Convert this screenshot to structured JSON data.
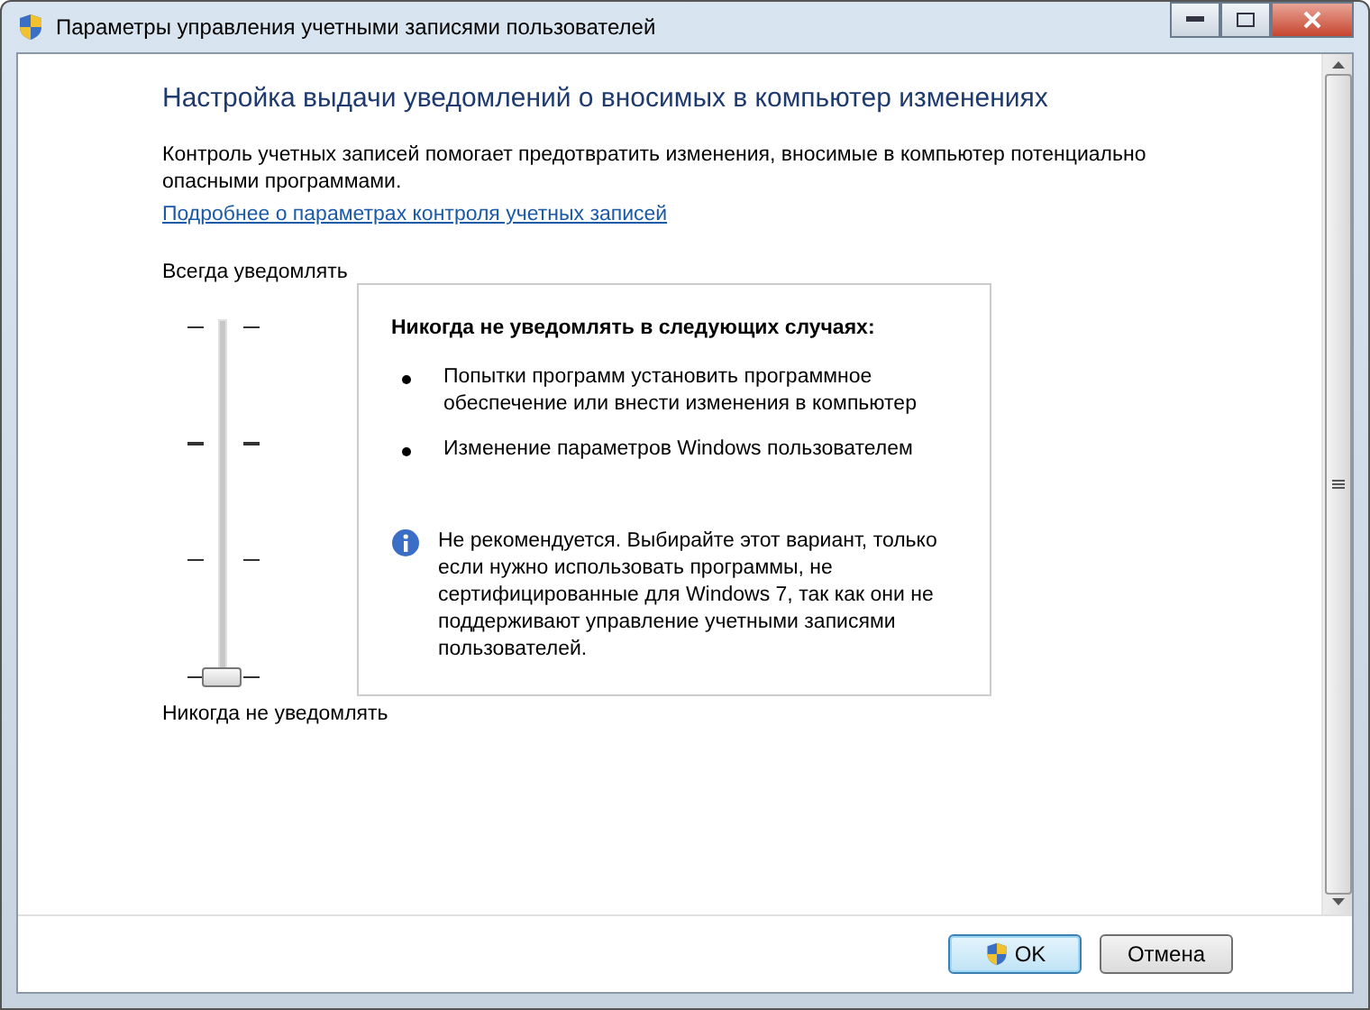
{
  "window": {
    "title": "Параметры управления учетными записями пользователей"
  },
  "heading": "Настройка выдачи уведомлений о вносимых в компьютер изменениях",
  "description": "Контроль учетных записей помогает предотвратить изменения, вносимые в компьютер потенциально опасными программами.",
  "link": "Подробнее о параметрах контроля учетных записей",
  "slider": {
    "top_label": "Всегда уведомлять",
    "bottom_label": "Никогда не уведомлять",
    "level": 0
  },
  "info_panel": {
    "title": "Никогда не уведомлять в следующих случаях:",
    "bullets": [
      "Попытки программ установить программное обеспечение или внести изменения в компьютер",
      "Изменение параметров Windows пользователем"
    ],
    "note": "Не рекомендуется. Выбирайте этот вариант, только если нужно использовать программы, не сертифицированные для Windows 7, так как они не поддерживают управление учетными записями пользователей."
  },
  "buttons": [
    {
      "label": "OK",
      "kind": "shield",
      "selected": true
    },
    {
      "label": "Отмена",
      "kind": "plain",
      "selected": false
    }
  ]
}
